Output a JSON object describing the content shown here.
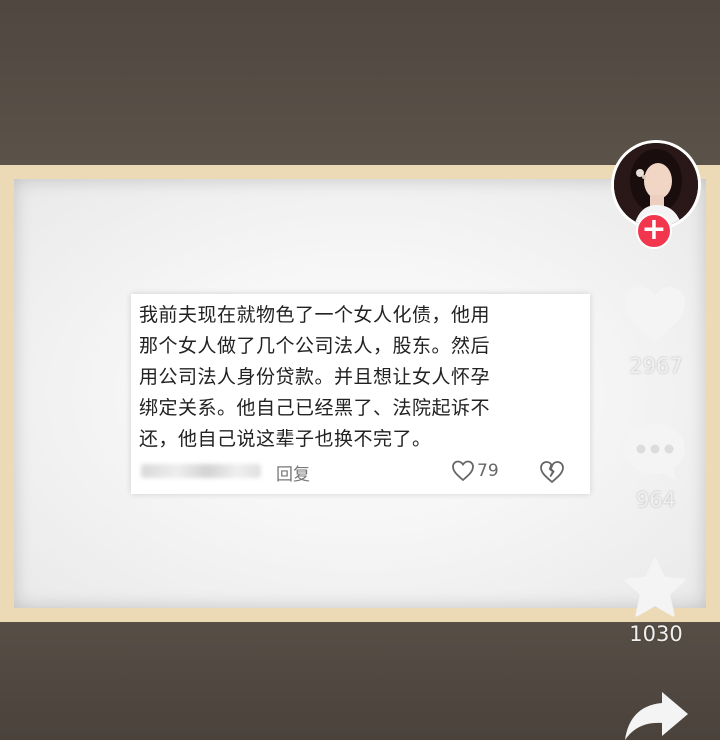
{
  "comment": {
    "lines": [
      "我前夫现在就物色了一个女人化债，他用",
      "那个女人做了几个公司法人，股东。然后",
      "用公司法人身份贷款。并且想让女人怀孕",
      "绑定关系。他自己已经黑了、法院起诉不",
      "还，他自己说这辈子也换不完了。"
    ],
    "reply_label": "回复",
    "like_count": "79"
  },
  "sidebar": {
    "follow_symbol": "+",
    "like_count": "2967",
    "comment_count": "964",
    "favorite_count": "1030"
  },
  "icons": {
    "like": "heart-icon",
    "comment": "chat-bubble-icon",
    "favorite": "star-icon",
    "share": "share-arrow-icon",
    "dislike": "broken-heart-icon"
  }
}
